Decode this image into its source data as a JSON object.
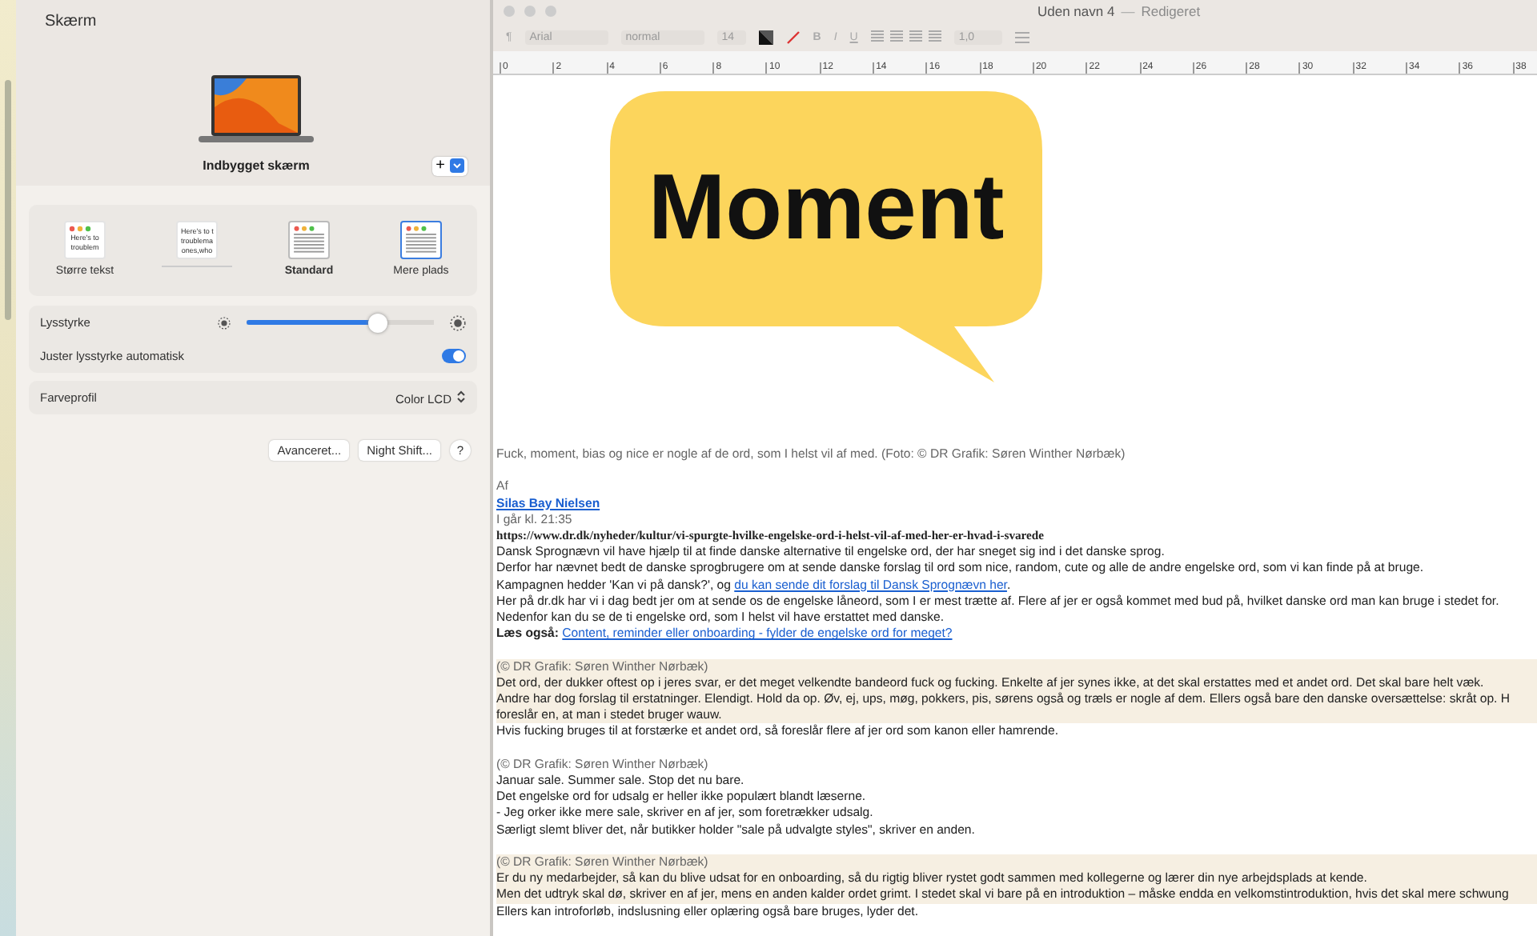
{
  "settings": {
    "title": "Skærm",
    "display_name": "Indbygget skærm",
    "add_button": "+",
    "scale_options": [
      {
        "label": "Større tekst",
        "selected": false,
        "current": false,
        "preview": [
          "Here's to",
          "troublem"
        ]
      },
      {
        "selected": false,
        "current": false,
        "preview": [
          "Here's to t",
          "troublema",
          "ones,who"
        ]
      },
      {
        "label": "Standard",
        "selected": false,
        "current": true
      },
      {
        "label": "Mere plads",
        "selected": true,
        "current": false
      }
    ],
    "brightness": {
      "label": "Lysstyrke",
      "level": 0.7
    },
    "auto_brightness": {
      "label": "Juster lysstyrke automatisk",
      "on": true
    },
    "color_profile": {
      "label": "Farveprofil",
      "value": "Color LCD"
    },
    "buttons": [
      "Avanceret...",
      "Night Shift...",
      "?"
    ]
  },
  "editor": {
    "title": "Uden navn 4",
    "separator": "—",
    "status": "Redigeret",
    "toolbar": {
      "paragraph": "¶",
      "font": "Arial",
      "style": "normal",
      "size": "14",
      "bold": "B",
      "italic": "I",
      "underline": "U",
      "spacing": "1,0"
    },
    "ruler": [
      "0",
      "2",
      "4",
      "6",
      "8",
      "10",
      "12",
      "14",
      "16",
      "18",
      "20",
      "22",
      "24",
      "26",
      "28",
      "30",
      "32",
      "34",
      "36",
      "38"
    ],
    "image": {
      "word": "Moment"
    },
    "lines": [
      {
        "kind": "caption",
        "text": "Fuck, moment, bias og nice er nogle af de ord, som I helst vil af med. (Foto: © DR Grafik: Søren Winther Nørbæk)",
        "highlight": false
      },
      {
        "kind": "blank",
        "highlight": false
      },
      {
        "kind": "muted",
        "text": "Af",
        "highlight": false
      },
      {
        "kind": "author",
        "text": "Silas Bay Nielsen",
        "highlight": false
      },
      {
        "kind": "muted",
        "text": "I går kl. 21:35",
        "highlight": false
      },
      {
        "kind": "url",
        "text": "https://www.dr.dk/nyheder/kultur/vi-spurgte-hvilke-engelske-ord-i-helst-vil-af-med-her-er-hvad-i-svarede",
        "highlight": false
      },
      {
        "kind": "text",
        "text": "Dansk Sprognævn vil have hjælp til at finde danske alternative til engelske ord, der har sneget sig ind i det danske sprog.",
        "highlight": false
      },
      {
        "kind": "text",
        "text": "Derfor har nævnet bedt de danske sprogbrugere om at sende danske forslag til ord som nice, random, cute og alle de andre engelske ord, som vi kan finde på at bruge.",
        "highlight": false
      },
      {
        "kind": "mixed",
        "text": "Kampagnen hedder 'Kan vi på dansk?', og ",
        "link": "du kan sende dit forslag til Dansk Sprognævn her",
        "after": ".",
        "highlight": false
      },
      {
        "kind": "text",
        "text": "Her på dr.dk har vi i dag bedt jer om at sende os de engelske låneord, som I er mest trætte af. Flere af jer er også kommet med bud på, hvilket danske ord man kan bruge i stedet for.",
        "highlight": false
      },
      {
        "kind": "text",
        "text": "Nedenfor kan du se de ti engelske ord, som I helst vil have erstattet med danske.",
        "highlight": false
      },
      {
        "kind": "read_also",
        "text": "Læs også:",
        "link": "Content, reminder eller onboarding - fylder de engelske ord for meget?",
        "highlight": false
      },
      {
        "kind": "blank",
        "highlight": false
      },
      {
        "kind": "muted",
        "text": "(© DR Grafik: Søren Winther Nørbæk)",
        "highlight": true
      },
      {
        "kind": "text",
        "text": "Det ord, der dukker oftest op i jeres svar, er det meget velkendte bandeord fuck og fucking. Enkelte af jer synes ikke, at det skal erstattes med et andet ord. Det skal bare helt væk.",
        "highlight": true
      },
      {
        "kind": "text",
        "text": "Andre har dog forslag til erstatninger. Elendigt. Hold da op. Øv, ej, ups, møg, pokkers, pis, sørens også og træls er nogle af dem. Ellers også bare den danske oversættelse: skråt op. H",
        "highlight": true
      },
      {
        "kind": "text",
        "text": "foreslår en, at man i stedet bruger wauw.",
        "highlight": true
      },
      {
        "kind": "text",
        "text": "Hvis fucking bruges til at forstærke et andet ord, så foreslår flere af jer ord som kanon eller hamrende.",
        "highlight": false
      },
      {
        "kind": "blank",
        "highlight": false
      },
      {
        "kind": "muted",
        "text": "(© DR Grafik: Søren Winther Nørbæk)",
        "highlight": false
      },
      {
        "kind": "text",
        "text": "Januar sale. Summer sale. Stop det nu bare.",
        "highlight": false
      },
      {
        "kind": "text",
        "text": "Det engelske ord for udsalg er heller ikke populært blandt læserne.",
        "highlight": false
      },
      {
        "kind": "text",
        "text": "- Jeg orker ikke mere sale, skriver en af jer, som foretrækker udsalg.",
        "highlight": false
      },
      {
        "kind": "text",
        "text": "Særligt slemt bliver det, når butikker holder \"sale på udvalgte styles\", skriver en anden.",
        "highlight": false
      },
      {
        "kind": "blank",
        "highlight": false
      },
      {
        "kind": "muted",
        "text": "(© DR Grafik: Søren Winther Nørbæk)",
        "highlight": true
      },
      {
        "kind": "text",
        "text": "Er du ny medarbejder, så kan du blive udsat for en onboarding, så du rigtig bliver rystet godt sammen med kollegerne og lærer din nye arbejdsplads at kende.",
        "highlight": true
      },
      {
        "kind": "text",
        "text": "Men det udtryk skal dø, skriver en af jer, mens en anden kalder ordet grimt. I stedet skal vi bare på en introduktion – måske endda en velkomstintroduktion, hvis det skal mere schwung",
        "highlight": true
      },
      {
        "kind": "text",
        "text": "Ellers kan introforløb, indslusning eller oplæring også bare bruges, lyder det.",
        "highlight": false
      }
    ]
  }
}
